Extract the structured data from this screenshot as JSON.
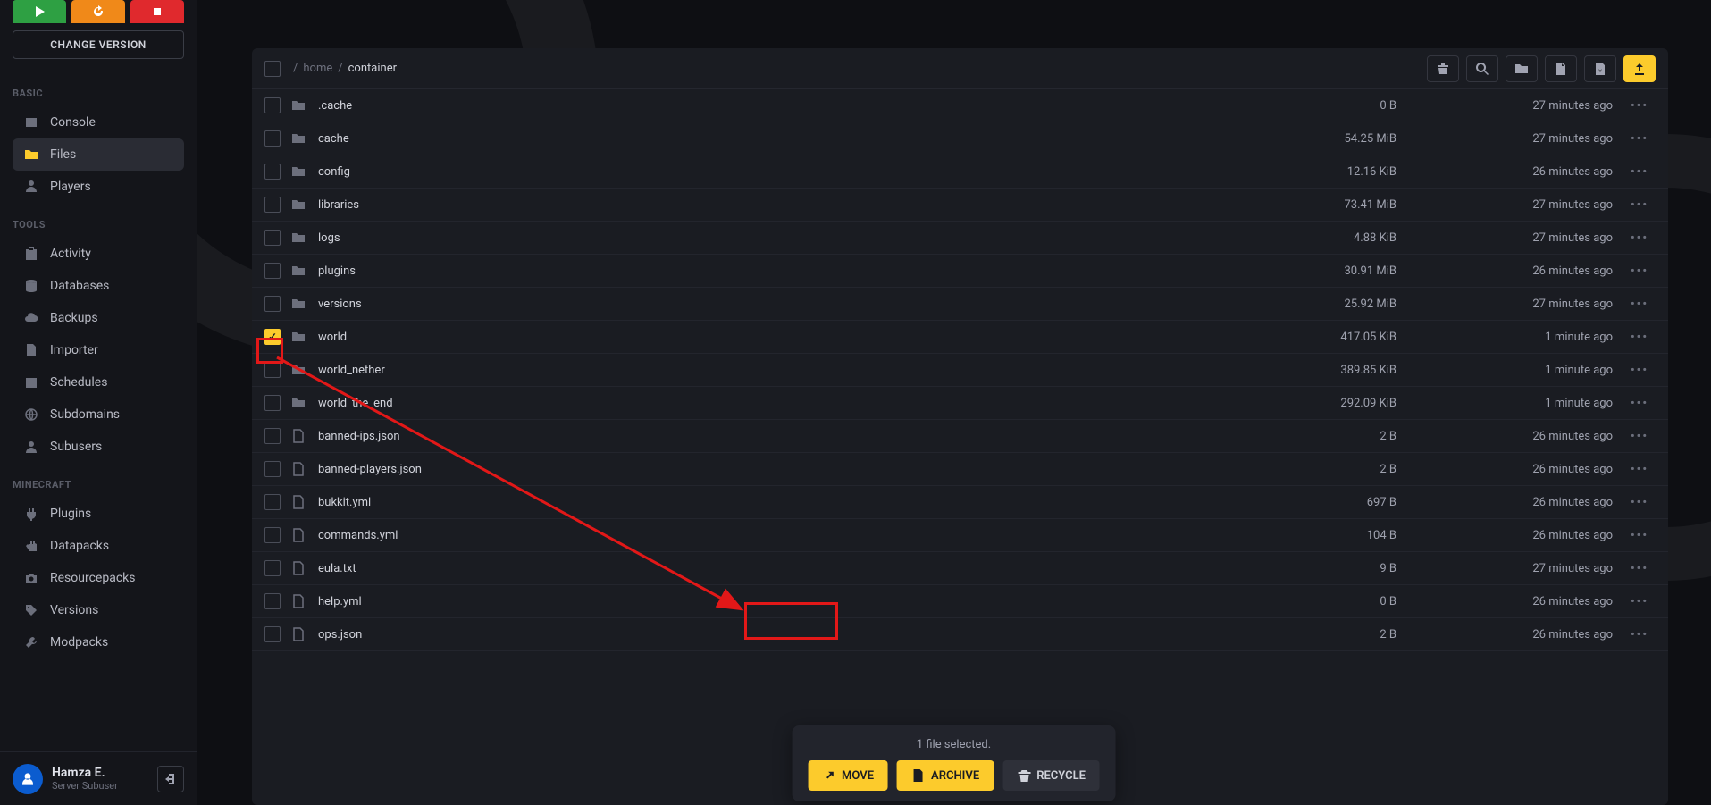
{
  "top_controls": {
    "change_version": "CHANGE VERSION"
  },
  "sections": {
    "basic": {
      "label": "BASIC",
      "items": [
        {
          "icon": "console",
          "label": "Console"
        },
        {
          "icon": "folder",
          "label": "Files",
          "active": true
        },
        {
          "icon": "players",
          "label": "Players"
        }
      ]
    },
    "tools": {
      "label": "TOOLS",
      "items": [
        {
          "icon": "clipboard",
          "label": "Activity"
        },
        {
          "icon": "database",
          "label": "Databases"
        },
        {
          "icon": "cloud",
          "label": "Backups"
        },
        {
          "icon": "import",
          "label": "Importer"
        },
        {
          "icon": "calendar",
          "label": "Schedules"
        },
        {
          "icon": "globe",
          "label": "Subdomains"
        },
        {
          "icon": "user",
          "label": "Subusers"
        }
      ]
    },
    "minecraft": {
      "label": "MINECRAFT",
      "items": [
        {
          "icon": "plug",
          "label": "Plugins"
        },
        {
          "icon": "hand",
          "label": "Datapacks"
        },
        {
          "icon": "camera",
          "label": "Resourcepacks"
        },
        {
          "icon": "tag",
          "label": "Versions"
        },
        {
          "icon": "wrench",
          "label": "Modpacks"
        }
      ]
    }
  },
  "user": {
    "name": "Hamza E.",
    "role": "Server Subuser"
  },
  "breadcrumb": {
    "home": "home",
    "current": "container"
  },
  "files": [
    {
      "type": "folder",
      "name": ".cache",
      "size": "0 B",
      "date": "27 minutes ago",
      "checked": false
    },
    {
      "type": "folder",
      "name": "cache",
      "size": "54.25 MiB",
      "date": "27 minutes ago",
      "checked": false
    },
    {
      "type": "folder",
      "name": "config",
      "size": "12.16 KiB",
      "date": "26 minutes ago",
      "checked": false
    },
    {
      "type": "folder",
      "name": "libraries",
      "size": "73.41 MiB",
      "date": "27 minutes ago",
      "checked": false
    },
    {
      "type": "folder",
      "name": "logs",
      "size": "4.88 KiB",
      "date": "27 minutes ago",
      "checked": false
    },
    {
      "type": "folder",
      "name": "plugins",
      "size": "30.91 MiB",
      "date": "26 minutes ago",
      "checked": false
    },
    {
      "type": "folder",
      "name": "versions",
      "size": "25.92 MiB",
      "date": "27 minutes ago",
      "checked": false
    },
    {
      "type": "folder",
      "name": "world",
      "size": "417.05 KiB",
      "date": "1 minute ago",
      "checked": true
    },
    {
      "type": "folder",
      "name": "world_nether",
      "size": "389.85 KiB",
      "date": "1 minute ago",
      "checked": false
    },
    {
      "type": "folder",
      "name": "world_the_end",
      "size": "292.09 KiB",
      "date": "1 minute ago",
      "checked": false
    },
    {
      "type": "file",
      "name": "banned-ips.json",
      "size": "2 B",
      "date": "26 minutes ago",
      "checked": false
    },
    {
      "type": "file",
      "name": "banned-players.json",
      "size": "2 B",
      "date": "26 minutes ago",
      "checked": false
    },
    {
      "type": "file",
      "name": "bukkit.yml",
      "size": "697 B",
      "date": "26 minutes ago",
      "checked": false
    },
    {
      "type": "file",
      "name": "commands.yml",
      "size": "104 B",
      "date": "26 minutes ago",
      "checked": false
    },
    {
      "type": "file",
      "name": "eula.txt",
      "size": "9 B",
      "date": "27 minutes ago",
      "checked": false
    },
    {
      "type": "file",
      "name": "help.yml",
      "size": "0 B",
      "date": "26 minutes ago",
      "checked": false
    },
    {
      "type": "file",
      "name": "ops.json",
      "size": "2 B",
      "date": "26 minutes ago",
      "checked": false
    }
  ],
  "selection": {
    "text": "1 file selected.",
    "move": "MOVE",
    "archive": "ARCHIVE",
    "recycle": "RECYCLE"
  }
}
